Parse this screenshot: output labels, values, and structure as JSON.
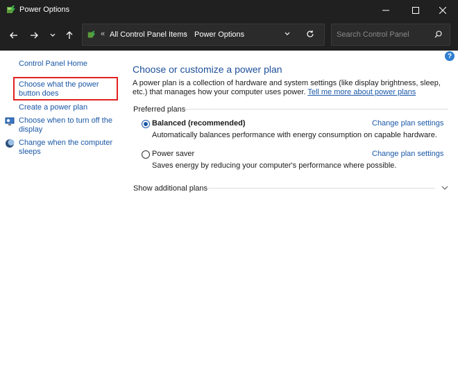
{
  "window": {
    "title": "Power Options",
    "icon": "power-options-icon",
    "controls": [
      "minimize-icon",
      "maximize-icon",
      "close-icon"
    ]
  },
  "navigation": {
    "back_icon": "arrow-left-icon",
    "forward_icon": "arrow-right-icon",
    "recent_icon": "chevron-down-icon",
    "up_icon": "arrow-up-icon",
    "address": {
      "overflow": "«",
      "crumbs": [
        "All Control Panel Items",
        "Power Options"
      ],
      "separator": "›"
    },
    "search": {
      "placeholder": "Search Control Panel",
      "value": ""
    }
  },
  "sidebar": {
    "home": "Control Panel Home",
    "items": [
      "Choose what the power button does",
      "Create a power plan",
      "Choose when to turn off the display",
      "Change when the computer sleeps"
    ]
  },
  "main": {
    "title": "Choose or customize a power plan",
    "intro_text": "A power plan is a collection of hardware and system settings (like display brightness, sleep, etc.) that manages how your computer uses power. ",
    "intro_link": "Tell me more about power plans",
    "preferred_label": "Preferred plans",
    "plans": [
      {
        "name": "Balanced (recommended)",
        "description": "Automatically balances performance with energy consumption on capable hardware.",
        "link": "Change plan settings",
        "selected": true
      },
      {
        "name": "Power saver",
        "description": "Saves energy by reducing your computer's performance where possible.",
        "link": "Change plan settings",
        "selected": false
      }
    ],
    "additional_label": "Show additional plans",
    "help_icon": "?"
  },
  "colors": {
    "titlebar": "#202020",
    "link": "#1a57a6",
    "heading": "#1e4f9a",
    "highlight": "#e02020"
  }
}
